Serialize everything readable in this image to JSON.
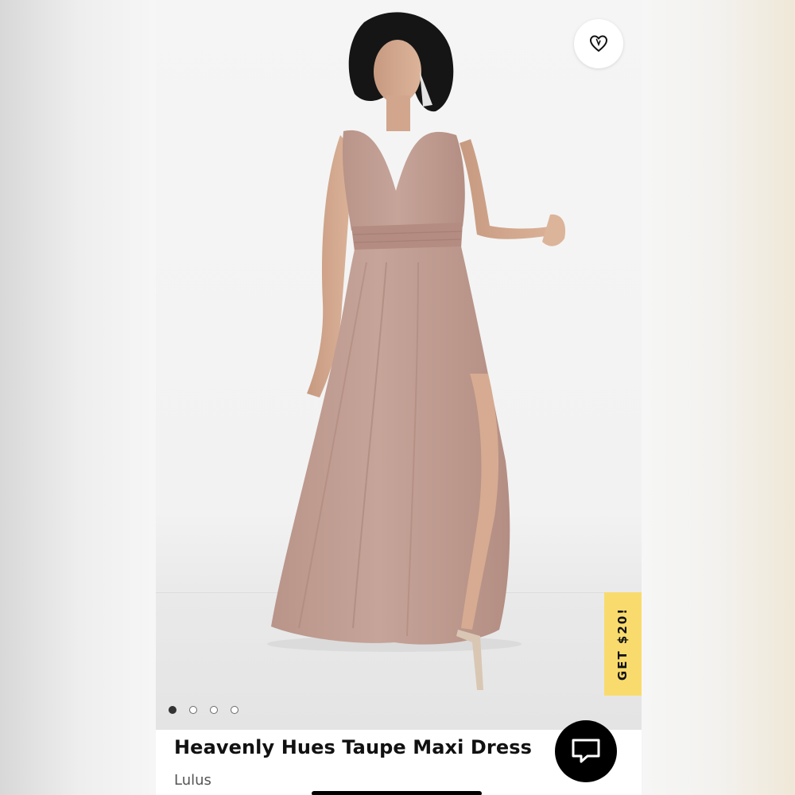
{
  "product": {
    "title": "Heavenly Hues Taupe Maxi Dress",
    "brand": "Lulus",
    "image_count": 4,
    "active_image_index": 0
  },
  "promo": {
    "label": "GET $20!",
    "color": "#f9db6d"
  },
  "icons": {
    "wishlist": "heart-icon",
    "chat": "chat-bubble-icon"
  },
  "colors": {
    "dress": "#bf9c92",
    "chat_button": "#000000"
  }
}
